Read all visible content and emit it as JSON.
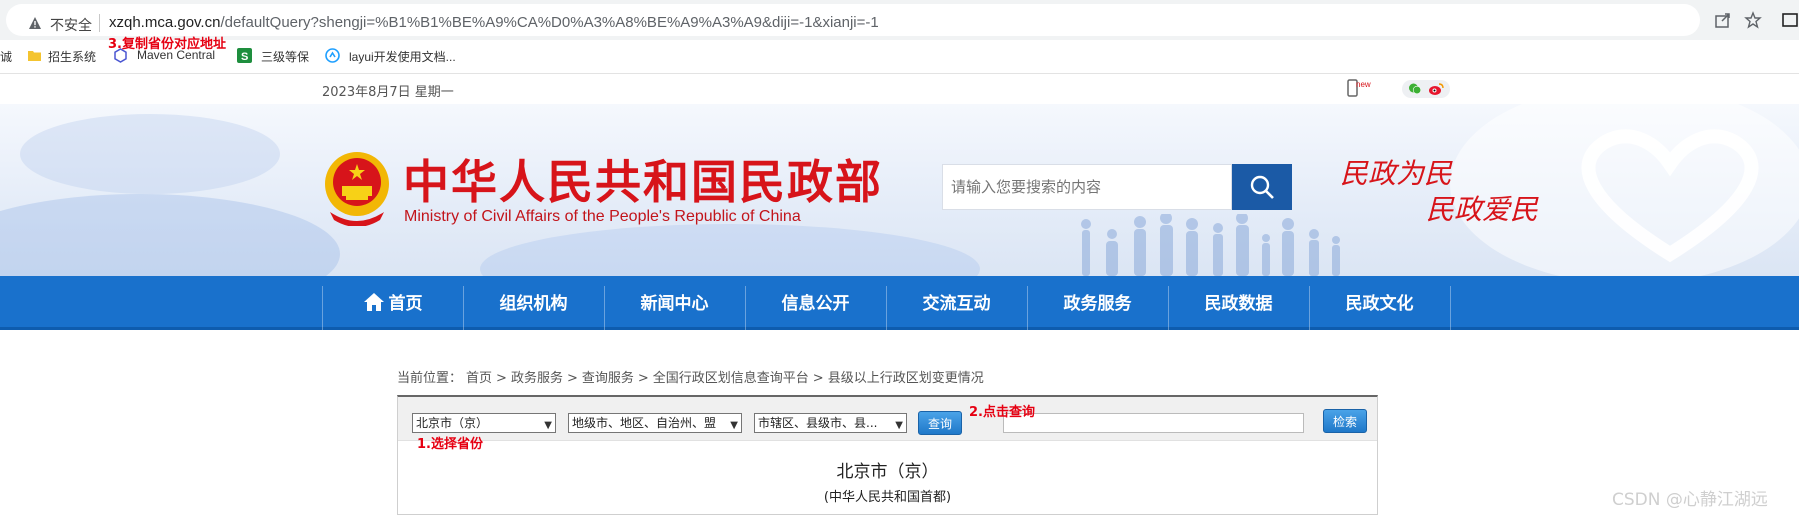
{
  "browser": {
    "security_label": "不安全",
    "url_host": "xzqh.mca.gov.cn",
    "url_rest": "/defaultQuery?shengji=%B1%B1%BE%A9%CA%D0%A3%A8%BE%A9%A3%A9&diji=-1&xianji=-1",
    "bookmarks": [
      {
        "label": "诚",
        "icon": "bookmark-cut-icon"
      },
      {
        "label": "招生系统",
        "icon": "folder-icon"
      },
      {
        "label": "Maven Central",
        "icon": "maven-hexagon-icon"
      },
      {
        "label": "三级等保",
        "icon": "green-s-icon"
      },
      {
        "label": "layui开发使用文档...",
        "icon": "layui-icon"
      }
    ]
  },
  "annotations": {
    "step3": "3.复制省份对应地址",
    "step2": "2.点击查询",
    "step1": "1.选择省份"
  },
  "topbar": {
    "date": "2023年8月7日 星期一",
    "new_badge": "new"
  },
  "header": {
    "title_cn": "中华人民共和国民政部",
    "title_en": "Ministry of Civil Affairs of the People's Republic of China",
    "search_placeholder": "请输入您要搜索的内容",
    "slogan_line1": "民政为民",
    "slogan_line2": "民政爱民"
  },
  "nav": {
    "items": [
      "首页",
      "组织机构",
      "新闻中心",
      "信息公开",
      "交流互动",
      "政务服务",
      "民政数据",
      "民政文化"
    ]
  },
  "breadcrumb": {
    "label": "当前位置：",
    "items": [
      "首页",
      "政务服务",
      "查询服务",
      "全国行政区划信息查询平台",
      "县级以上行政区划变更情况"
    ],
    "sep": ">"
  },
  "query": {
    "province_value": "北京市（京）",
    "city_value": "地级市、地区、自治州、盟",
    "county_value": "市辖区、县级市、县...",
    "query_button": "查询",
    "search_button": "检索",
    "search_value": ""
  },
  "result": {
    "title": "北京市（京）",
    "subtitle": "(中华人民共和国首都)"
  },
  "watermark": "CSDN @心静江湖远",
  "colors": {
    "nav_blue": "#1971cc",
    "title_red": "#d7141a",
    "search_blue": "#1b5aa6",
    "annotation_red": "#e60012"
  }
}
